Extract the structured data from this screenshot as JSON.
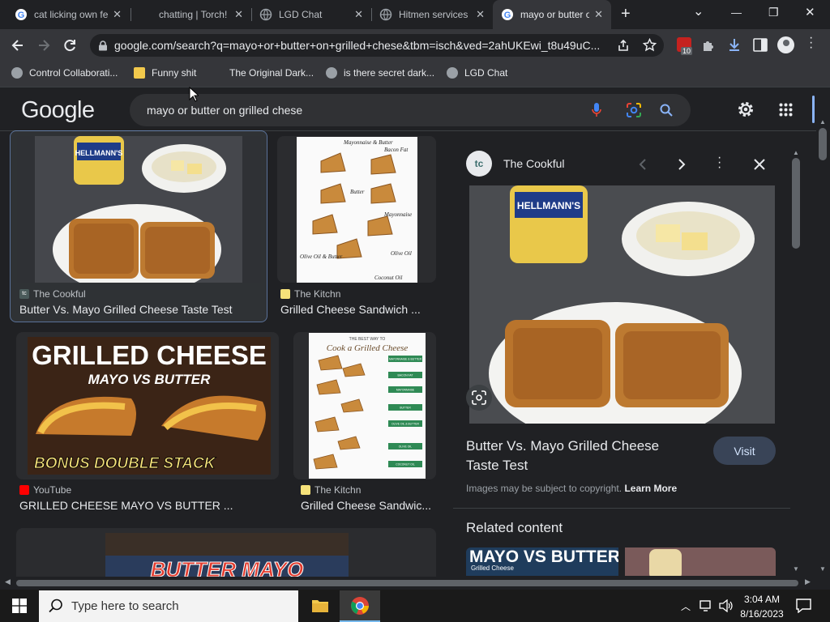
{
  "tabs": [
    {
      "title": "cat licking own feet"
    },
    {
      "title": "chatting | Torch!"
    },
    {
      "title": "LGD Chat"
    },
    {
      "title": "Hitmen services"
    },
    {
      "title": "mayo or butter on grilled chese"
    }
  ],
  "window": {
    "minimize": "—",
    "restore": "❐",
    "close": "✕",
    "dropdown": "⌄",
    "new_tab": "+"
  },
  "address": {
    "url": "google.com/search?q=mayo+or+butter+on+grilled+chese&tbm=isch&ved=2ahUKEwi_t8u49uC...",
    "ext_badge": "10"
  },
  "bookmarks": [
    {
      "label": "Control Collaborati..."
    },
    {
      "label": "Funny shit"
    },
    {
      "label": "The Original Dark..."
    },
    {
      "label": "is there secret dark..."
    },
    {
      "label": "LGD Chat"
    }
  ],
  "google": {
    "logo": "Google",
    "query": "mayo or butter on grilled chese"
  },
  "results": [
    {
      "source": "The Cookful",
      "title": "Butter Vs. Mayo Grilled Cheese Taste Test",
      "src_badge": "tc"
    },
    {
      "source": "The Kitchn",
      "title": "Grilled Cheese Sandwich ..."
    },
    {
      "source": "YouTube",
      "title": "GRILLED CHEESE MAYO VS BUTTER ..."
    },
    {
      "source": "The Kitchn",
      "title": "Grilled Cheese Sandwic..."
    }
  ],
  "thumb_text": {
    "kitchn1_labels": [
      "Mayonnaise & Butter",
      "Bacon Fat",
      "Butter",
      "Mayonnaise",
      "Olive Oil & Butter",
      "Olive Oil",
      "Coconut Oil"
    ],
    "jar": "HELLMANN'S",
    "yt_line1": "GRILLED CHEESE",
    "yt_line2": "MAYO  VS  BUTTER",
    "yt_line3": "BONUS DOUBLE STACK",
    "kitchn2_title": "THE BEST WAY TO",
    "kitchn2_script": "Cook a Grilled Cheese",
    "kitchn2_labels": [
      "MAYONNAISE & BUTTER",
      "BACON FAT",
      "MAYONNAISE",
      "BUTTER",
      "OLIVE OIL & BUTTER",
      "OLIVE OIL",
      "COCONUT OIL"
    ],
    "bottom": "BUTTER   MAYO",
    "related_left": "MAYO VS BUTTER",
    "related_sub": "Grilled Cheese"
  },
  "panel": {
    "badge": "tc",
    "source": "The Cookful",
    "title_line1": "Butter Vs. Mayo Grilled Cheese",
    "title_line2": "Taste Test",
    "visit": "Visit",
    "copyright": "Images may be subject to copyright.",
    "learn_more": "Learn More",
    "related": "Related content"
  },
  "taskbar": {
    "search_placeholder": "Type here to search",
    "time": "3:04 AM",
    "date": "8/16/2023"
  },
  "colors": {
    "accent": "#8ab4f8",
    "panel_bg": "#202124",
    "selected_border": "#8ab4f8"
  }
}
